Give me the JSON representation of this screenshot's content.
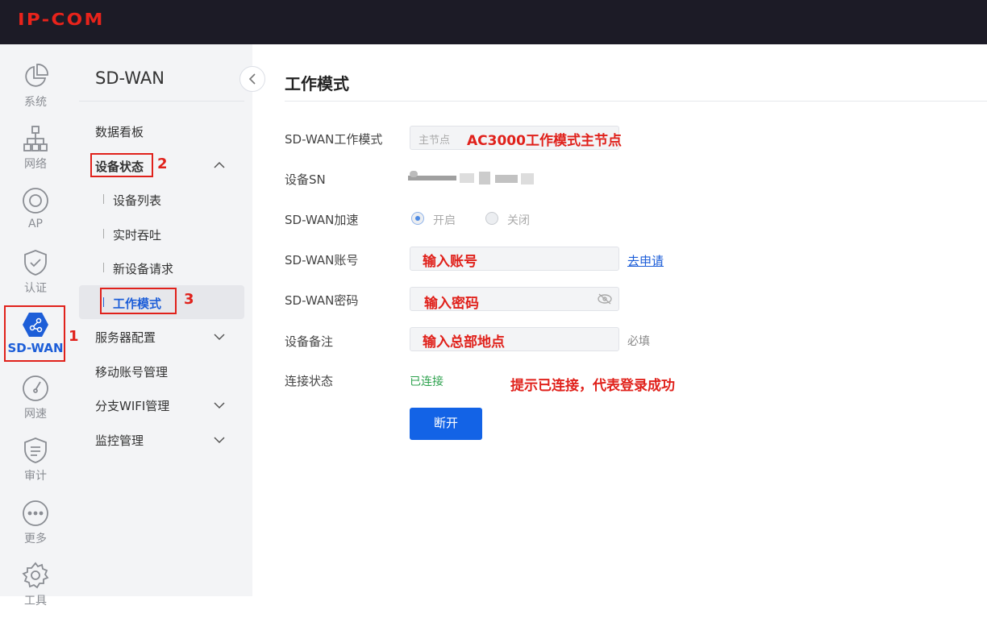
{
  "header": {
    "logo": "IP-COM"
  },
  "rail": {
    "items": [
      {
        "label": "系统",
        "icon": "pie-chart-icon"
      },
      {
        "label": "网络",
        "icon": "network-topology-icon"
      },
      {
        "label": "AP",
        "icon": "ap-icon"
      },
      {
        "label": "认证",
        "icon": "shield-check-icon"
      },
      {
        "label": "SD-WAN",
        "icon": "sdwan-hexagon-icon",
        "active": true
      },
      {
        "label": "网速",
        "icon": "speedometer-icon"
      },
      {
        "label": "审计",
        "icon": "audit-shield-icon"
      },
      {
        "label": "更多",
        "icon": "more-dots-icon"
      },
      {
        "label": "工具",
        "icon": "gear-icon"
      }
    ]
  },
  "sidebar": {
    "title": "SD-WAN",
    "items": [
      {
        "label": "数据看板"
      },
      {
        "label": "设备状态",
        "expanded": true,
        "children": [
          "设备列表",
          "实时吞吐",
          "新设备请求",
          "工作模式"
        ]
      },
      {
        "label": "服务器配置"
      },
      {
        "label": "移动账号管理"
      },
      {
        "label": "分支WIFI管理"
      },
      {
        "label": "监控管理"
      }
    ],
    "active_child": "工作模式"
  },
  "main": {
    "title": "工作模式",
    "form": {
      "mode_label": "SD-WAN工作模式",
      "mode_value": "主节点",
      "sn_label": "设备SN",
      "accel_label": "SD-WAN加速",
      "accel_on": "开启",
      "accel_off": "关闭",
      "account_label": "SD-WAN账号",
      "apply_link": "去申请",
      "password_label": "SD-WAN密码",
      "note_label": "设备备注",
      "required_hint": "必填",
      "status_label": "连接状态",
      "status_value": "已连接",
      "disconnect_button": "断开"
    }
  },
  "annotations": {
    "mode": "AC3000工作模式主节点",
    "account": "输入账号",
    "password": "输入密码",
    "note": "输入总部地点",
    "status": "提示已连接，代表登录成功",
    "step1": "1",
    "step2": "2",
    "step3": "3"
  },
  "colors": {
    "accent": "#1363e6",
    "annotation": "#e0211b",
    "connected": "#2ca14d",
    "topbar": "#1c1b26"
  }
}
